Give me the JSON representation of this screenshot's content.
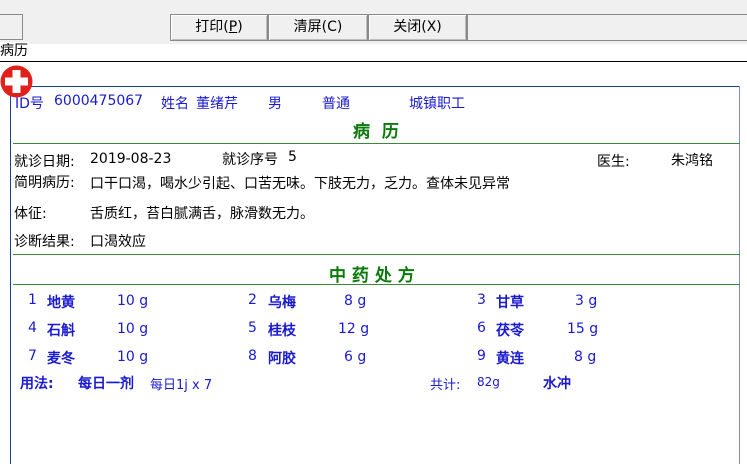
{
  "toolbar": {
    "print_label": "打印(",
    "print_key": "P",
    "clear_label": "清屏(C)",
    "close_label": "关闭(X)"
  },
  "tab": {
    "label": "病历"
  },
  "patient": {
    "id_label": "ID号",
    "id_value": "6000475067",
    "name_label": "姓名",
    "name_value": "董绪芹",
    "gender": "男",
    "type": "普通",
    "insurance": "城镇职工"
  },
  "record": {
    "title": "病  历",
    "visit_date_label": "就诊日期:",
    "visit_date": "2019-08-23",
    "visit_no_label": "就诊序号",
    "visit_no": "5",
    "doctor_label": "医生:",
    "doctor": "朱鸿铭",
    "history_label": "简明病历:",
    "history": "口干口渴，喝水少引起、口苦无味。下肢无力，乏力。查体未见异常",
    "signs_label": "体征:",
    "signs": "舌质红，苔白腻满舌，脉滑数无力。",
    "diagnosis_label": "诊断结果:",
    "diagnosis": "口渴效应"
  },
  "prescription": {
    "title": "中 药 处 方",
    "herbs": [
      {
        "no": "1",
        "name": "地黄",
        "dose": "10 g"
      },
      {
        "no": "2",
        "name": "乌梅",
        "dose": "8 g"
      },
      {
        "no": "3",
        "name": "甘草",
        "dose": "3 g"
      },
      {
        "no": "4",
        "name": "石斛",
        "dose": "10 g"
      },
      {
        "no": "5",
        "name": "桂枝",
        "dose": "12 g"
      },
      {
        "no": "6",
        "name": "茯苓",
        "dose": "15 g"
      },
      {
        "no": "7",
        "name": "麦冬",
        "dose": "10 g"
      },
      {
        "no": "8",
        "name": "阿胶",
        "dose": "6 g"
      },
      {
        "no": "9",
        "name": "黄连",
        "dose": "8 g"
      }
    ],
    "usage_label": "用法:",
    "usage_value": "每日一剂",
    "usage_detail": "每日1j x 7",
    "total_label": "共计:",
    "total_value": "82g",
    "method": "水冲"
  },
  "colors": {
    "blue_text": "#1a1ad0",
    "green_text": "#0a7a0a",
    "rx_red": "#e0201a"
  },
  "icons": {
    "rx": "red-cross-icon"
  }
}
